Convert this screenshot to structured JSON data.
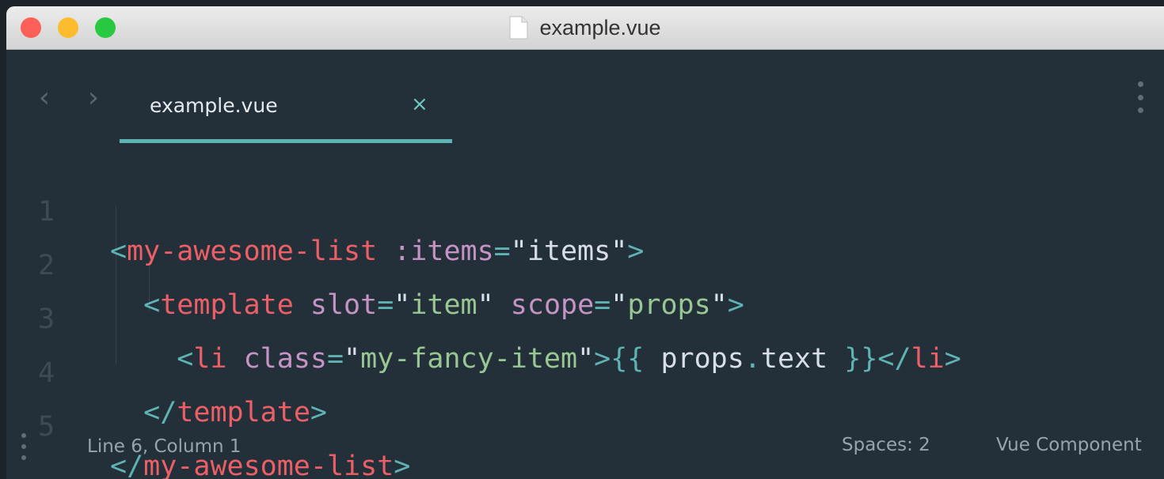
{
  "window": {
    "title": "example.vue"
  },
  "tabs": [
    {
      "label": "example.vue",
      "close_glyph": "×",
      "active": true
    }
  ],
  "navigation": {
    "back_glyph": "‹",
    "forward_glyph": "›"
  },
  "editor": {
    "line_numbers": [
      "1",
      "2",
      "3",
      "4",
      "5"
    ],
    "lines": [
      [
        {
          "t": "<",
          "k": "punc"
        },
        {
          "t": "my-awesome-list",
          "k": "tag"
        },
        {
          "t": " ",
          "k": "text"
        },
        {
          "t": ":items",
          "k": "attr"
        },
        {
          "t": "=",
          "k": "eq"
        },
        {
          "t": "\"",
          "k": "q"
        },
        {
          "t": "items",
          "k": "text"
        },
        {
          "t": "\"",
          "k": "q"
        },
        {
          "t": ">",
          "k": "punc"
        }
      ],
      [
        {
          "t": "  ",
          "k": "text"
        },
        {
          "t": "<",
          "k": "punc"
        },
        {
          "t": "template",
          "k": "tag"
        },
        {
          "t": " ",
          "k": "text"
        },
        {
          "t": "slot",
          "k": "attr"
        },
        {
          "t": "=",
          "k": "eq"
        },
        {
          "t": "\"",
          "k": "q"
        },
        {
          "t": "item",
          "k": "str"
        },
        {
          "t": "\"",
          "k": "q"
        },
        {
          "t": " ",
          "k": "text"
        },
        {
          "t": "scope",
          "k": "attr"
        },
        {
          "t": "=",
          "k": "eq"
        },
        {
          "t": "\"",
          "k": "q"
        },
        {
          "t": "props",
          "k": "str"
        },
        {
          "t": "\"",
          "k": "q"
        },
        {
          "t": ">",
          "k": "punc"
        }
      ],
      [
        {
          "t": "    ",
          "k": "text"
        },
        {
          "t": "<",
          "k": "punc"
        },
        {
          "t": "li",
          "k": "tag"
        },
        {
          "t": " ",
          "k": "text"
        },
        {
          "t": "class",
          "k": "attr"
        },
        {
          "t": "=",
          "k": "eq"
        },
        {
          "t": "\"",
          "k": "q"
        },
        {
          "t": "my-fancy-item",
          "k": "str"
        },
        {
          "t": "\"",
          "k": "q"
        },
        {
          "t": ">",
          "k": "punc"
        },
        {
          "t": "{{",
          "k": "punc"
        },
        {
          "t": " props",
          "k": "text"
        },
        {
          "t": ".",
          "k": "punc"
        },
        {
          "t": "text ",
          "k": "text"
        },
        {
          "t": "}}",
          "k": "punc"
        },
        {
          "t": "</",
          "k": "punc"
        },
        {
          "t": "li",
          "k": "tag"
        },
        {
          "t": ">",
          "k": "punc"
        }
      ],
      [
        {
          "t": "  ",
          "k": "text"
        },
        {
          "t": "</",
          "k": "punc"
        },
        {
          "t": "template",
          "k": "tag"
        },
        {
          "t": ">",
          "k": "punc"
        }
      ],
      [
        {
          "t": "</",
          "k": "punc"
        },
        {
          "t": "my-awesome-list",
          "k": "tag"
        },
        {
          "t": ">",
          "k": "punc"
        }
      ]
    ]
  },
  "status_bar": {
    "cursor_position": "Line 6, Column 1",
    "indentation": "Spaces: 2",
    "syntax": "Vue Component"
  },
  "colors": {
    "background": "#243039",
    "tab_underline": "#5fb3b3",
    "tag": "#ec5f67",
    "attribute": "#c594c5",
    "string": "#99c794",
    "punctuation": "#5fb3b3",
    "text": "#d8dee9"
  }
}
